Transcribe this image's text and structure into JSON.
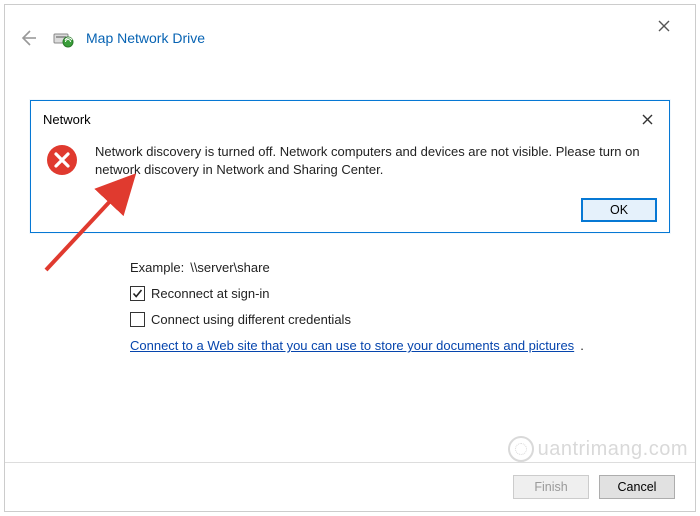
{
  "window": {
    "title": "Map Network Drive",
    "close_tooltip": "Close"
  },
  "alert": {
    "title": "Network",
    "message": "Network discovery is turned off. Network computers and devices are not visible. Please turn on network discovery in Network and Sharing Center.",
    "ok_label": "OK"
  },
  "form": {
    "example_prefix": "Example:",
    "example_value": "\\\\server\\share",
    "reconnect_label": "Reconnect at sign-in",
    "reconnect_checked": true,
    "diffcreds_label": "Connect using different credentials",
    "diffcreds_checked": false,
    "website_link": "Connect to a Web site that you can use to store your documents and pictures"
  },
  "buttons": {
    "finish": "Finish",
    "cancel": "Cancel"
  },
  "watermark": "uantrimang.com"
}
